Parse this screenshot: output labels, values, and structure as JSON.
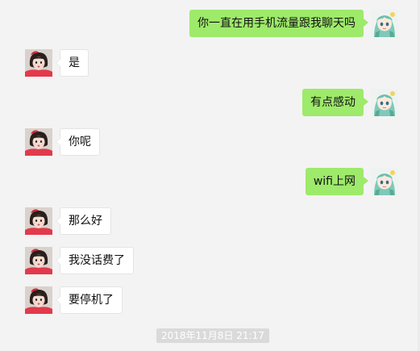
{
  "conversation": {
    "messages": [
      {
        "side": "right",
        "text": "你一直在用手机流量跟我聊天吗",
        "avatar": "anime-girl-avatar"
      },
      {
        "side": "left",
        "text": "是",
        "avatar": "girl-photo-avatar"
      },
      {
        "side": "right",
        "text": "有点感动",
        "avatar": "anime-girl-avatar"
      },
      {
        "side": "left",
        "text": "你呢",
        "avatar": "girl-photo-avatar"
      },
      {
        "side": "right",
        "text": "wifi上网",
        "avatar": "anime-girl-avatar"
      },
      {
        "side": "left",
        "text": "那么好",
        "avatar": "girl-photo-avatar"
      },
      {
        "side": "left",
        "text": "我没话费了",
        "avatar": "girl-photo-avatar"
      },
      {
        "side": "left",
        "text": "要停机了",
        "avatar": "girl-photo-avatar"
      }
    ],
    "timestamp": "2018年11月8日 21:17"
  },
  "colors": {
    "background": "#f3f3f3",
    "sent_bubble": "#9eea6a",
    "received_bubble": "#ffffff",
    "timestamp_bg": "#dadada"
  }
}
